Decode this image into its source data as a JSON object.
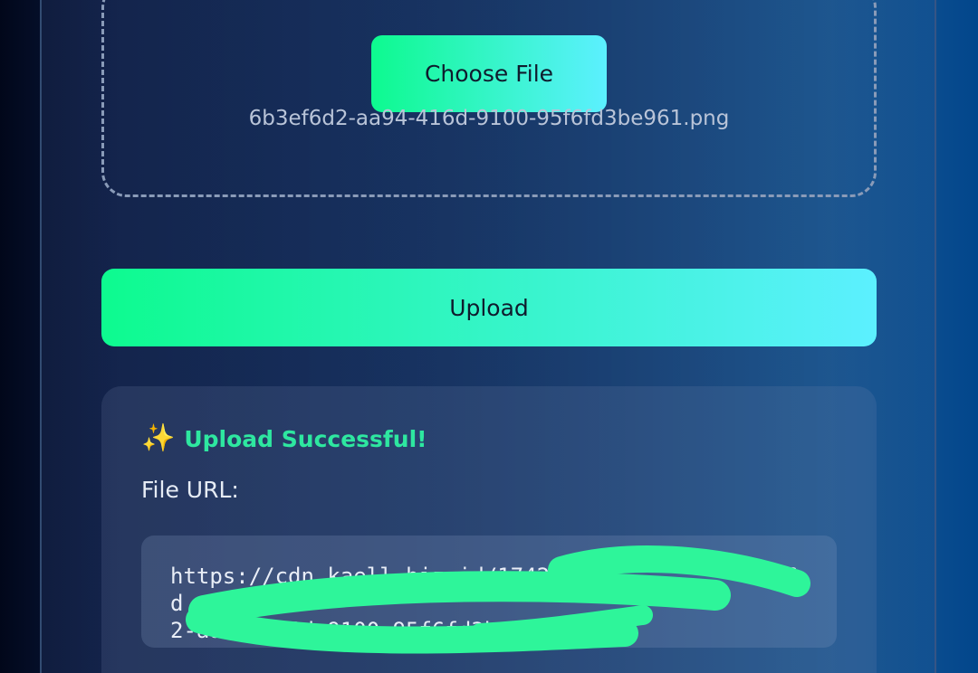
{
  "uploader": {
    "choose_file_label": "Choose File",
    "selected_filename": "6b3ef6d2-aa94-416d-9100-95f6fd3be961.png",
    "upload_label": "Upload"
  },
  "result": {
    "success_icon": "sparkles-icon",
    "success_text": "Upload Successful!",
    "file_url_label": "File URL:",
    "file_url": "https://cdn.kaell.biz.id/1742",
    "file_url_tail_line1": "f6d",
    "file_url_line2": "2-aa94-416d-9100-95f6fd3be961.png"
  },
  "colors": {
    "accent_gradient_start": "#0dfa8f",
    "accent_gradient_end": "#5cf0ff",
    "success_text": "#2ee7a0",
    "redaction": "#2ef59a"
  }
}
